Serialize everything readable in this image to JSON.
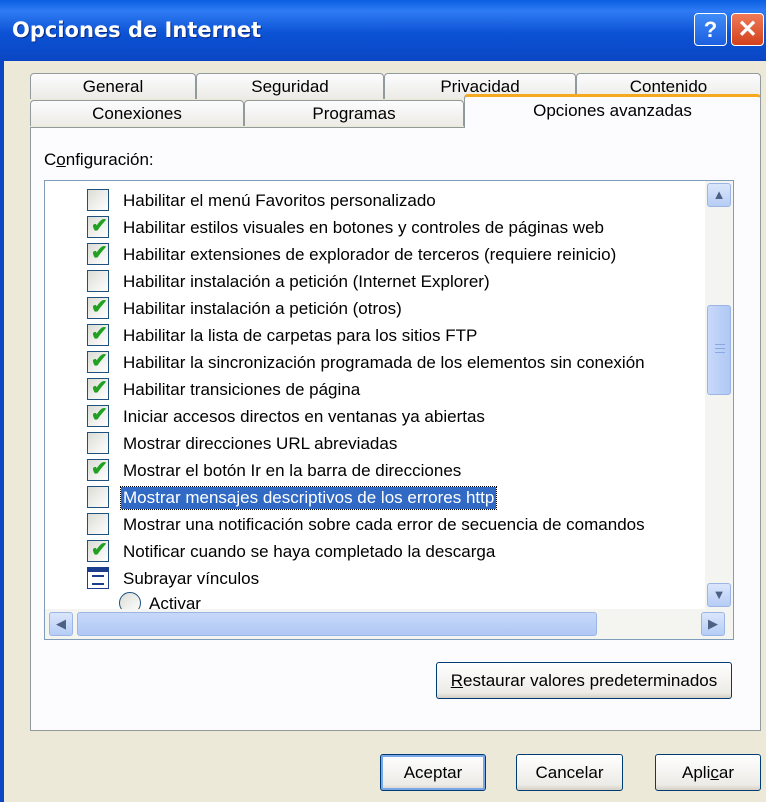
{
  "window": {
    "title": "Opciones de Internet",
    "help_label": "?",
    "close_label": "✕"
  },
  "tabs": {
    "row1": [
      "General",
      "Seguridad",
      "Privacidad",
      "Contenido"
    ],
    "row2": [
      "Conexiones",
      "Programas",
      "Opciones avanzadas"
    ],
    "active": "Opciones avanzadas"
  },
  "settings": {
    "label_prefix": "C",
    "label_underlined": "o",
    "label_suffix": "nfiguración:",
    "items": [
      {
        "label": "Habilitar el menú Favoritos personalizado",
        "type": "checkbox",
        "checked": false
      },
      {
        "label": "Habilitar estilos visuales en botones y controles de páginas web",
        "type": "checkbox",
        "checked": true
      },
      {
        "label": "Habilitar extensiones de explorador de terceros (requiere reinicio)",
        "type": "checkbox",
        "checked": true
      },
      {
        "label": "Habilitar instalación a petición (Internet Explorer)",
        "type": "checkbox",
        "checked": false
      },
      {
        "label": "Habilitar instalación a petición (otros)",
        "type": "checkbox",
        "checked": true
      },
      {
        "label": "Habilitar la lista de carpetas para los sitios FTP",
        "type": "checkbox",
        "checked": true
      },
      {
        "label": "Habilitar la sincronización programada de los elementos sin conexión",
        "type": "checkbox",
        "checked": true
      },
      {
        "label": "Habilitar transiciones de página",
        "type": "checkbox",
        "checked": true
      },
      {
        "label": "Iniciar accesos directos en ventanas ya abiertas",
        "type": "checkbox",
        "checked": true
      },
      {
        "label": "Mostrar direcciones URL abreviadas",
        "type": "checkbox",
        "checked": false
      },
      {
        "label": "Mostrar el botón Ir en la barra de direcciones",
        "type": "checkbox",
        "checked": true
      },
      {
        "label": "Mostrar mensajes descriptivos de los errores http",
        "type": "checkbox",
        "checked": false,
        "selected": true
      },
      {
        "label": "Mostrar una notificación sobre cada error de secuencia de comandos",
        "type": "checkbox",
        "checked": false
      },
      {
        "label": "Notificar cuando se haya completado la descarga",
        "type": "checkbox",
        "checked": true
      },
      {
        "label": "Subrayar vínculos",
        "type": "group"
      },
      {
        "label": "Activar",
        "type": "radio",
        "checked": false
      }
    ]
  },
  "scrollbar": {
    "up_icon": "▲",
    "down_icon": "▼",
    "left_icon": "◀",
    "right_icon": "▶",
    "vertical_position": 0.55,
    "horizontal_position": 0.0
  },
  "buttons": {
    "restore_underlined": "R",
    "restore_rest": "estaurar valores predeterminados",
    "ok": "Aceptar",
    "cancel": "Cancelar",
    "apply_prefix": "Apli",
    "apply_underlined": "c",
    "apply_suffix": "ar"
  },
  "colors": {
    "titlebar": "#0a5fe0",
    "selection": "#316ac5",
    "check": "#21a121",
    "active_tab_accent": "#f6a81f"
  }
}
